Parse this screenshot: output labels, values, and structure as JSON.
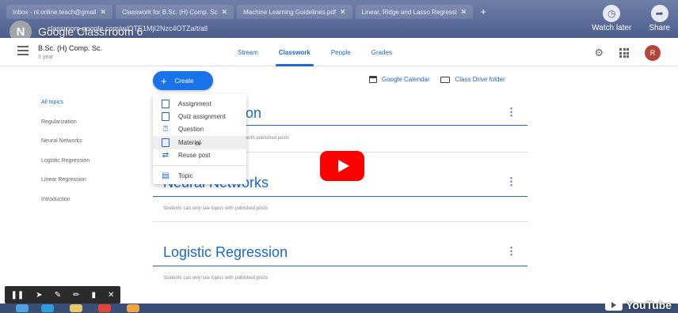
{
  "browser": {
    "tabs": [
      {
        "label": "Inbox - ni.online.teach@gmail"
      },
      {
        "label": "Classwork for B.Sc. (H) Comp. Sc"
      },
      {
        "label": "Machine Learning Guidelines.pdf"
      },
      {
        "label": "Linear, Ridge and Lasso Regressi"
      }
    ],
    "tab_close": "✕",
    "new_tab": "+",
    "address": "classroom.google.com/w/OTE1MjI2Nzc4OTZa/t/all"
  },
  "youtube": {
    "channel_initial": "N",
    "video_title": "Google Classrroom 6",
    "watch_later_label": "Watch later",
    "share_label": "Share",
    "logo_text": "YouTube"
  },
  "classroom": {
    "course_name": "B.Sc. (H) Comp. Sc.",
    "course_sub": "II year",
    "tabs": [
      "Stream",
      "Classwork",
      "People",
      "Grades"
    ],
    "active_tab": "Classwork",
    "user_initial": "R",
    "create_label": "Create",
    "calendar_link": "Google Calendar",
    "drive_link": "Class Drive folder",
    "topics": [
      "All topics",
      "Regularization",
      "Neural Networks",
      "Logistic Regression",
      "Linear Regression",
      "Introduction"
    ],
    "active_topic": "All topics",
    "sections": [
      {
        "title": "on",
        "note": "with published posts"
      },
      {
        "title": "Neural Networks",
        "note": "Students can only see topics with published posts"
      },
      {
        "title": "Logistic Regression",
        "note": "Students can only see topics with published posts"
      }
    ],
    "menu_icon": "⋮"
  },
  "create_menu": {
    "items": [
      {
        "label": "Assignment"
      },
      {
        "label": "Quiz assignment"
      },
      {
        "label": "Question"
      },
      {
        "label": "Material"
      },
      {
        "label": "Reuse post"
      }
    ],
    "topic_label": "Topic",
    "hovered": "Material"
  },
  "colors": {
    "accent": "#1967d2",
    "create_button": "#1a73e8",
    "play_button": "#ff0000",
    "avatar": "#b5453a"
  }
}
